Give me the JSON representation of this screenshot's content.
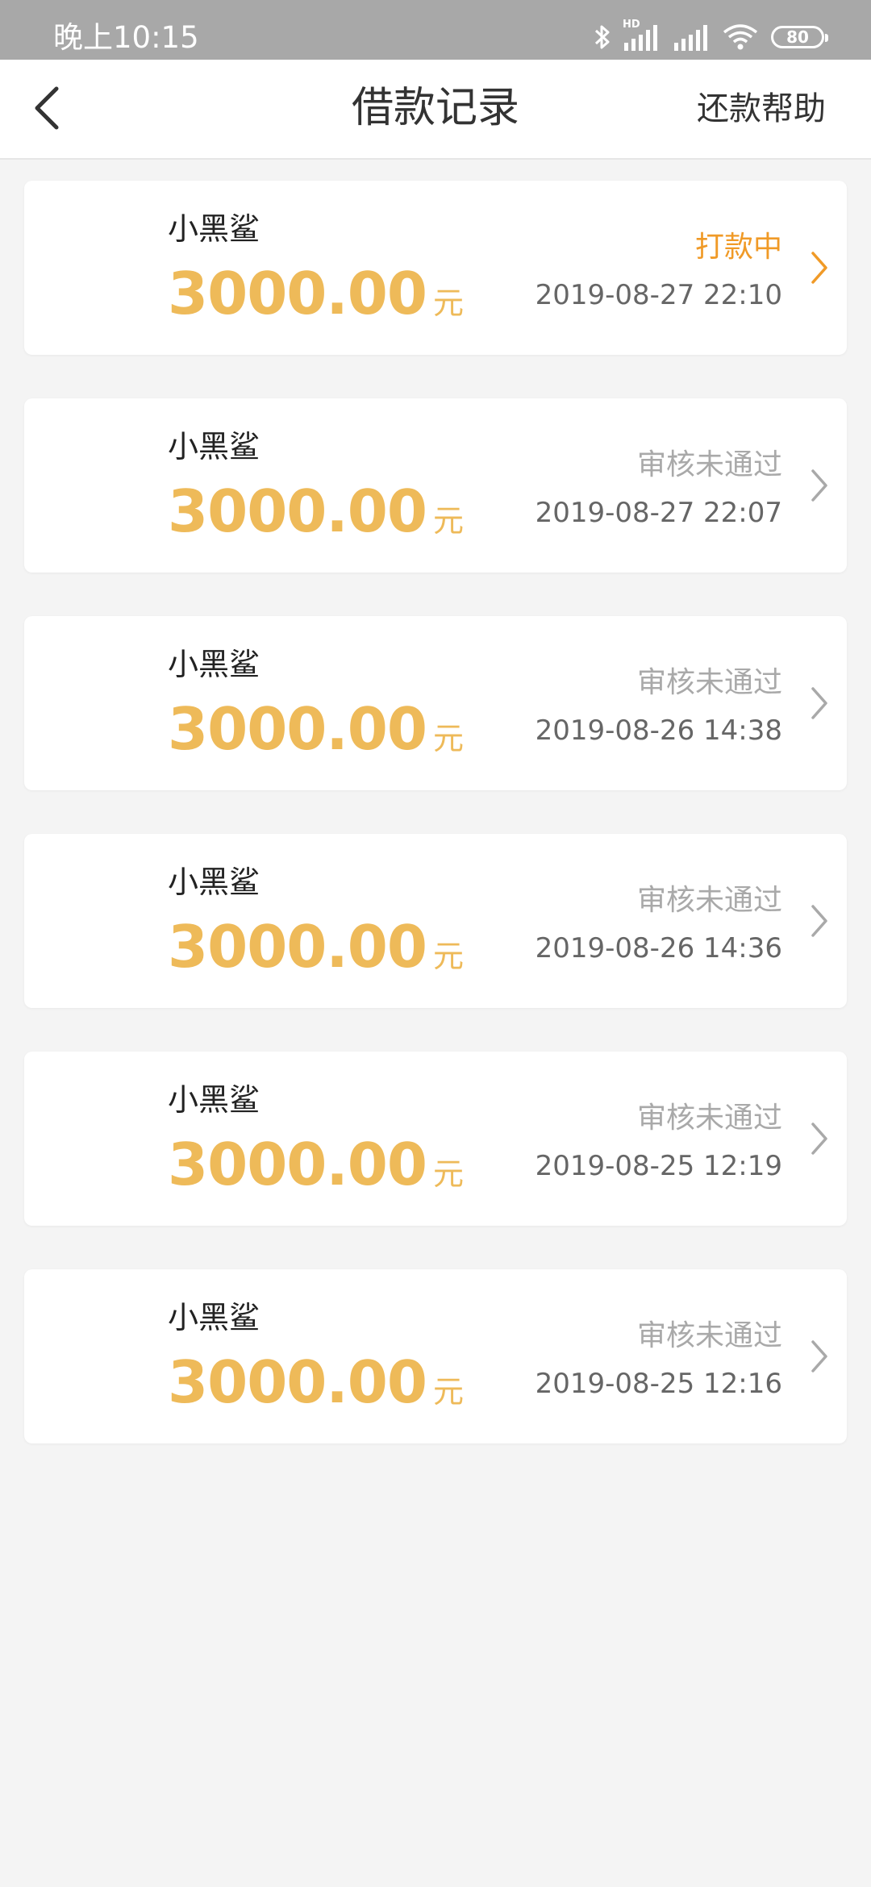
{
  "status_bar": {
    "time": "晚上10:15",
    "battery": "80",
    "hd_label": "HD",
    "icons": [
      "bluetooth-icon",
      "signal-hd-icon",
      "signal-icon",
      "wifi-icon",
      "battery-icon"
    ]
  },
  "header": {
    "title": "借款记录",
    "help": "还款帮助",
    "back_icon": "chevron-left-icon"
  },
  "colors": {
    "amount": "#eeba59",
    "status_active": "#f09a27",
    "status_inactive": "#a9a9a9",
    "chevron_active": "#f09a27",
    "chevron_inactive": "#a9a9a9"
  },
  "records": [
    {
      "name": "小黑鲨",
      "amount": "3000.00",
      "unit": "元",
      "status": "打款中",
      "date": "2019-08-27 22:10",
      "active": true
    },
    {
      "name": "小黑鲨",
      "amount": "3000.00",
      "unit": "元",
      "status": "审核未通过",
      "date": "2019-08-27 22:07",
      "active": false
    },
    {
      "name": "小黑鲨",
      "amount": "3000.00",
      "unit": "元",
      "status": "审核未通过",
      "date": "2019-08-26 14:38",
      "active": false
    },
    {
      "name": "小黑鲨",
      "amount": "3000.00",
      "unit": "元",
      "status": "审核未通过",
      "date": "2019-08-26 14:36",
      "active": false
    },
    {
      "name": "小黑鲨",
      "amount": "3000.00",
      "unit": "元",
      "status": "审核未通过",
      "date": "2019-08-25 12:19",
      "active": false
    },
    {
      "name": "小黑鲨",
      "amount": "3000.00",
      "unit": "元",
      "status": "审核未通过",
      "date": "2019-08-25 12:16",
      "active": false
    }
  ]
}
